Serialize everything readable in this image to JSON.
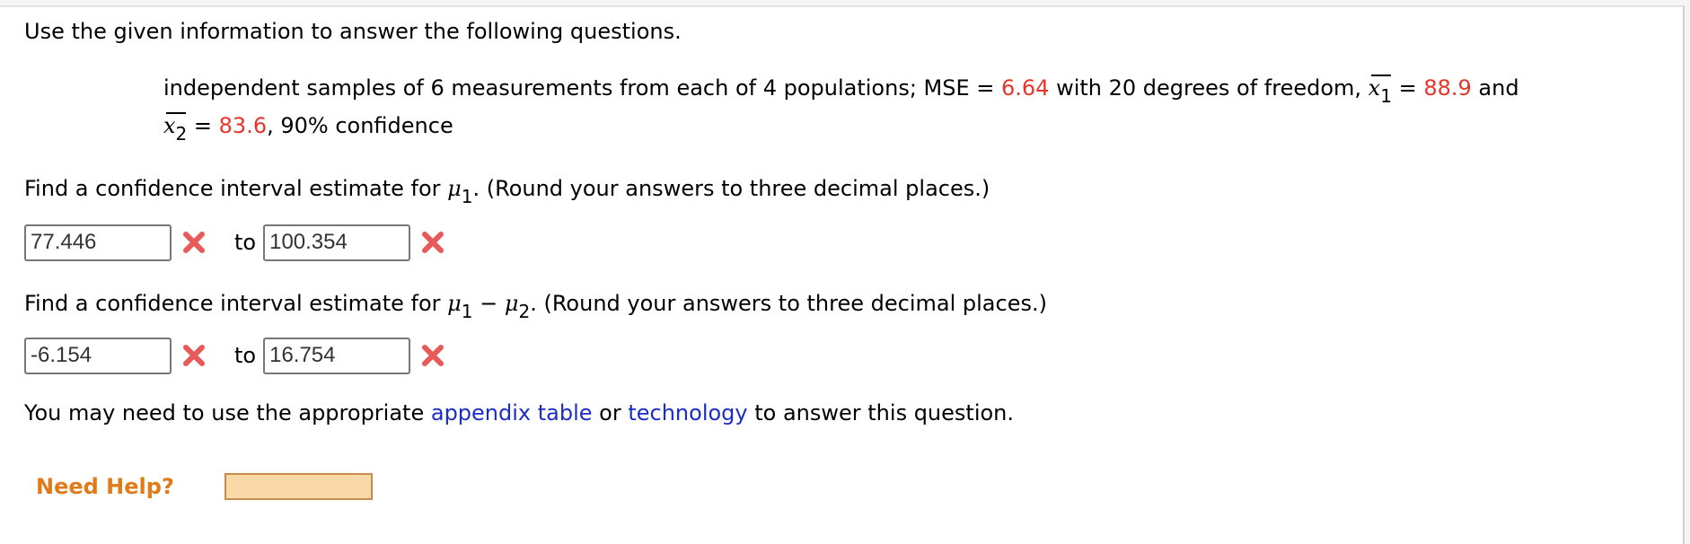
{
  "instructions": "Use the given information to answer the following questions.",
  "given": {
    "prefix": "independent samples of 6 measurements from each of 4 populations; MSE = ",
    "mse": "6.64",
    "mid": " with 20 degrees of freedom, ",
    "xbar1_var": "x",
    "xbar1_sub": "1",
    "eq1": " = ",
    "xbar1_value": "88.9",
    "and": " and",
    "xbar2_var": "x",
    "xbar2_sub": "2",
    "eq2": " = ",
    "xbar2_value": "83.6",
    "suffix": ", 90% confidence",
    "value_color": "#e8352b"
  },
  "q1": {
    "prompt_pre": "Find a confidence interval estimate for ",
    "mu": "μ",
    "mu_sub": "1",
    "prompt_post": ". (Round your answers to three decimal places.)",
    "lower_value": "77.446",
    "upper_value": "100.354",
    "to_label": "to",
    "lower_status": "incorrect",
    "upper_status": "incorrect"
  },
  "q2": {
    "prompt_pre": "Find a confidence interval estimate for ",
    "mu1": "μ",
    "mu1_sub": "1",
    "minus": " − ",
    "mu2": "μ",
    "mu2_sub": "2",
    "prompt_post": ". (Round your answers to three decimal places.)",
    "lower_value": "-6.154",
    "upper_value": "16.754",
    "to_label": "to",
    "lower_status": "incorrect",
    "upper_status": "incorrect"
  },
  "note": {
    "pre": "You may need to use the appropriate ",
    "link1": "appendix table",
    "mid": " or ",
    "link2": "technology",
    "post": " to answer this question.",
    "link_color": "#1a2dc4"
  },
  "help": {
    "label": "Need Help?"
  },
  "icons": {
    "incorrect": "close-x-icon"
  }
}
